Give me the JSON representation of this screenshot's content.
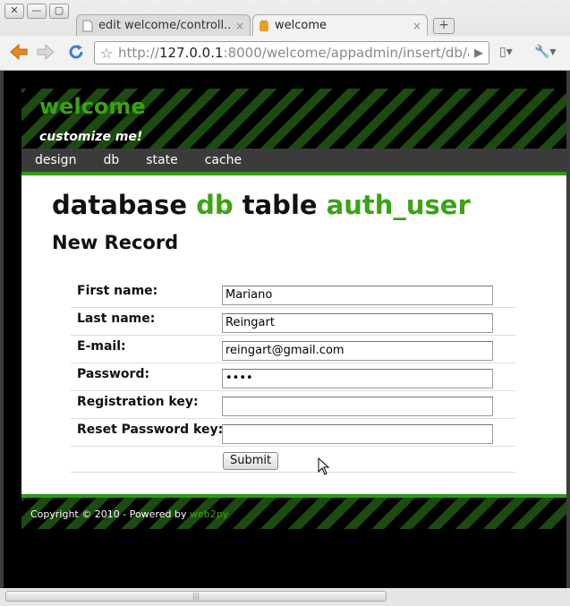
{
  "browser": {
    "tabs": [
      {
        "title": "edit welcome/controll...",
        "close": "×"
      },
      {
        "title": "welcome",
        "close": "×"
      }
    ],
    "new_tab": "+",
    "url_host": "127.0.0.1",
    "url_prefix": "http://",
    "url_rest": ":8000/welcome/appadmin/insert/db/a",
    "window_buttons": [
      "✕",
      "—",
      "▢"
    ],
    "icons": {
      "back": "back-arrow-icon",
      "forward": "forward-arrow-icon",
      "reload": "reload-icon",
      "star": "star-icon",
      "page": "page-menu-icon",
      "wrench": "wrench-menu-icon"
    }
  },
  "site": {
    "brand": "welcome",
    "slogan": "customize me!",
    "menu": [
      "design",
      "db",
      "state",
      "cache"
    ]
  },
  "heading": {
    "part1": "database ",
    "db_name": "db",
    "part2": " table ",
    "table_name": "auth_user"
  },
  "subheading": "New Record",
  "form": {
    "fields": [
      {
        "label": "First name:",
        "value": "Mariano"
      },
      {
        "label": "Last name:",
        "value": "Reingart"
      },
      {
        "label": "E-mail:",
        "value": "reingart@gmail.com"
      },
      {
        "label": "Password:",
        "value": "••••"
      },
      {
        "label": "Registration key:",
        "value": ""
      },
      {
        "label": "Reset Password key:",
        "value": ""
      }
    ],
    "submit_label": "Submit"
  },
  "footer": {
    "text": "Copyright © 2010 - Powered by ",
    "link": "web2py"
  },
  "colors": {
    "accent": "#3aa315",
    "menubar": "#3b3b3b",
    "stripe": "#1c4a10"
  }
}
